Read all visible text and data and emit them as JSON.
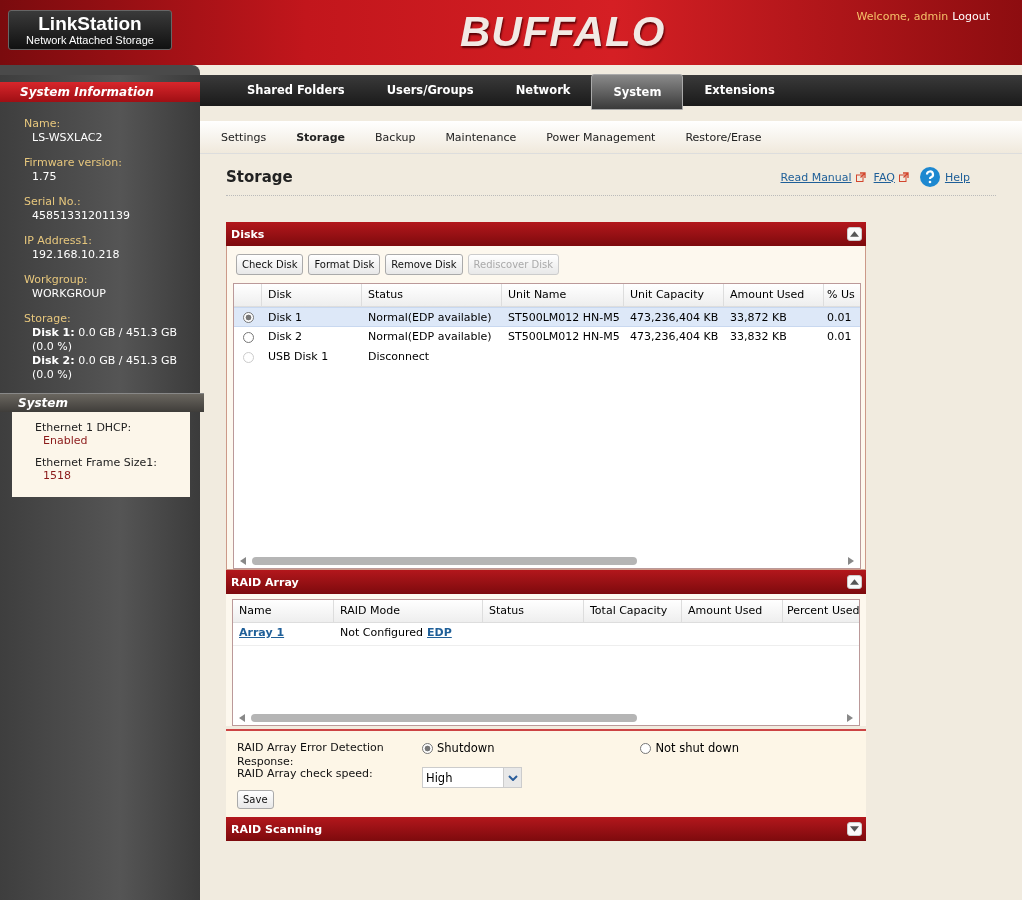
{
  "header": {
    "product": "LinkStation",
    "product_subtitle": "Network Attached Storage",
    "brand": "BUFFALO",
    "welcome": "Welcome, admin",
    "logout": "Logout"
  },
  "main_tabs": [
    {
      "label": "Shared Folders",
      "selected": false
    },
    {
      "label": "Users/Groups",
      "selected": false
    },
    {
      "label": "Network",
      "selected": false
    },
    {
      "label": "System",
      "selected": true
    },
    {
      "label": "Extensions",
      "selected": false
    }
  ],
  "sub_tabs": [
    {
      "label": "Settings",
      "selected": false
    },
    {
      "label": "Storage",
      "selected": true
    },
    {
      "label": "Backup",
      "selected": false
    },
    {
      "label": "Maintenance",
      "selected": false
    },
    {
      "label": "Power Management",
      "selected": false
    },
    {
      "label": "Restore/Erase",
      "selected": false
    }
  ],
  "sidebar": {
    "title": "System Information",
    "items": [
      {
        "label": "Name:",
        "values": [
          "LS-WSXLAC2"
        ]
      },
      {
        "label": "Firmware version:",
        "values": [
          "1.75"
        ]
      },
      {
        "label": "Serial No.:",
        "values": [
          "45851331201139"
        ]
      },
      {
        "label": "IP Address1:",
        "values": [
          "192.168.10.218"
        ]
      },
      {
        "label": "Workgroup:",
        "values": [
          "WORKGROUP"
        ]
      },
      {
        "label": "Storage:",
        "values": [
          "**Disk 1:** 0.0 GB / 451.3 GB (0.0 %)",
          "**Disk 2:** 0.0 GB / 451.3 GB (0.0 %)"
        ]
      }
    ],
    "system_title": "System",
    "system_items": [
      {
        "label": "Ethernet 1 DHCP:",
        "value": "Enabled"
      },
      {
        "label": "Ethernet Frame Size1:",
        "value": "1518"
      }
    ]
  },
  "page": {
    "title": "Storage",
    "links": [
      {
        "label": "Read Manual",
        "kind": "external"
      },
      {
        "label": "FAQ",
        "kind": "external"
      },
      {
        "label": "Help",
        "kind": "help"
      }
    ]
  },
  "disks": {
    "title": "Disks",
    "expanded": true,
    "buttons": [
      {
        "label": "Check Disk",
        "disabled": false
      },
      {
        "label": "Format Disk",
        "disabled": false
      },
      {
        "label": "Remove Disk",
        "disabled": false
      },
      {
        "label": "Rediscover Disk",
        "disabled": true
      }
    ],
    "columns": [
      "Disk",
      "Status",
      "Unit Name",
      "Unit Capacity",
      "Amount Used",
      "% Us"
    ],
    "rows": [
      {
        "selected": true,
        "disabled": false,
        "cells": [
          "Disk 1",
          "Normal(EDP available)",
          "ST500LM012 HN-M5",
          "473,236,404 KB",
          "33,872 KB",
          "0.01"
        ]
      },
      {
        "selected": false,
        "disabled": false,
        "cells": [
          "Disk 2",
          "Normal(EDP available)",
          "ST500LM012 HN-M5",
          "473,236,404 KB",
          "33,832 KB",
          "0.01"
        ]
      },
      {
        "selected": false,
        "disabled": true,
        "cells": [
          "USB Disk 1",
          "Disconnect",
          "",
          "",
          "",
          ""
        ]
      }
    ]
  },
  "raid": {
    "title": "RAID Array",
    "expanded": true,
    "columns": [
      "Name",
      "RAID Mode",
      "Status",
      "Total Capacity",
      "Amount Used",
      "Percent Used"
    ],
    "rows": [
      {
        "name": "Array 1",
        "mode": "Not Configured",
        "mode_link": "EDP"
      }
    ],
    "error_label": "RAID Array Error Detection Response:",
    "error_options": [
      {
        "label": "Shutdown",
        "selected": true
      },
      {
        "label": "Not shut down",
        "selected": false
      }
    ],
    "speed_label": "RAID Array check speed:",
    "speed_value": "High",
    "save": "Save"
  },
  "scanning": {
    "title": "RAID Scanning",
    "expanded": false
  }
}
